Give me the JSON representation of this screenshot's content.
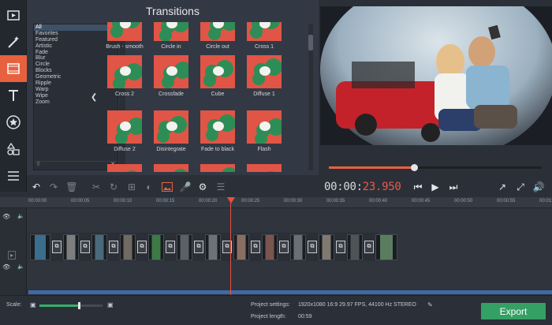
{
  "panel": {
    "title": "Transitions"
  },
  "categories": [
    "All",
    "Favorites",
    "Featured",
    "Artistic",
    "Fade",
    "Blur",
    "Circle",
    "Blocks",
    "Geometric",
    "Ripple",
    "Warp",
    "Wipe",
    "Zoom"
  ],
  "transitions": [
    {
      "label": "Brush - smooth"
    },
    {
      "label": "Circle in"
    },
    {
      "label": "Circle out"
    },
    {
      "label": "Cross 1"
    },
    {
      "label": "Cross 2"
    },
    {
      "label": "Crossfade"
    },
    {
      "label": "Cube"
    },
    {
      "label": "Diffuse 1"
    },
    {
      "label": "Diffuse 2"
    },
    {
      "label": "Disintegrate"
    },
    {
      "label": "Fade to black"
    },
    {
      "label": "Flash"
    },
    {
      "label": ""
    },
    {
      "label": ""
    },
    {
      "label": ""
    },
    {
      "label": ""
    }
  ],
  "player": {
    "time_main": "00:00:",
    "time_red": "23.950",
    "progress": 0.4
  },
  "ruler": [
    "00:00:00",
    "00:00:05",
    "00:00:10",
    "00:00:15",
    "00:00:20",
    "00:00:25",
    "00:00:30",
    "00:00:35",
    "00:00:40",
    "00:00:45",
    "00:00:50",
    "00:00:55",
    "00:01:00"
  ],
  "bottom": {
    "scale_label": "Scale:",
    "project_settings_label": "Project settings:",
    "project_settings_value": "1920x1080 16:9 29.97 FPS, 44100 Hz STEREO",
    "project_length_label": "Project length:",
    "project_length_value": "00:59",
    "export_label": "Export",
    "scale_value": 0.62
  },
  "colors": {
    "accent": "#e8613f",
    "export": "#35a064",
    "timecode_red": "#e85b4c"
  }
}
